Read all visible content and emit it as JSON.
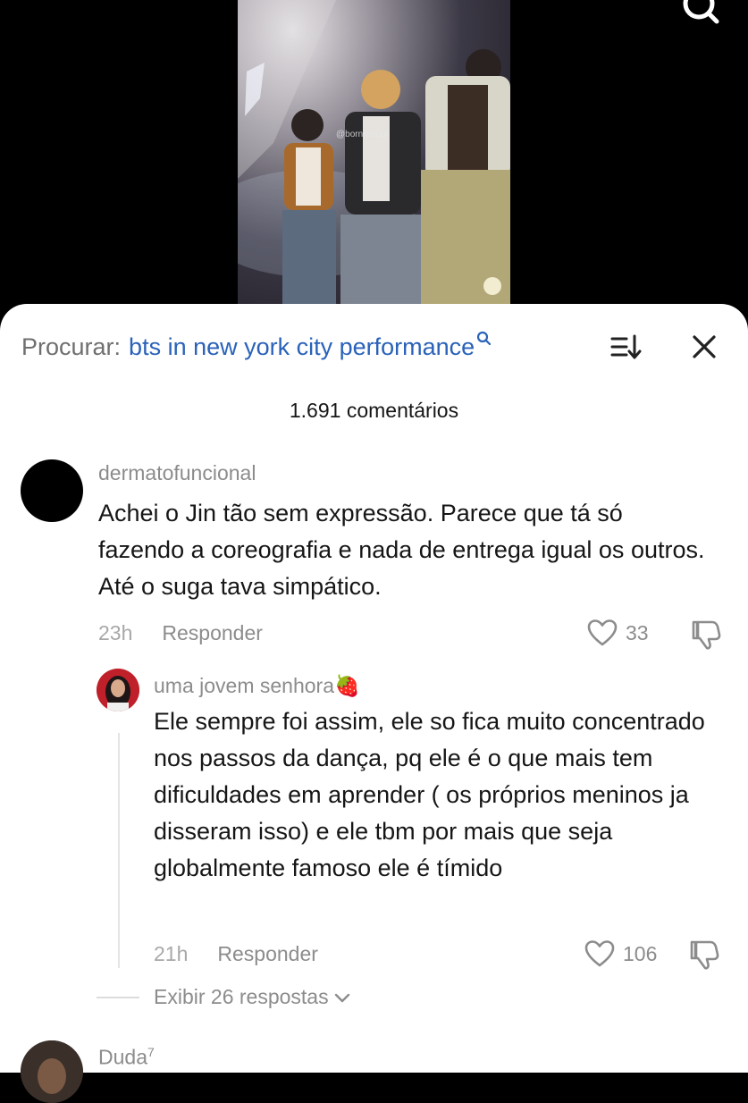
{
  "video": {
    "watermark": "@bornfortour"
  },
  "search": {
    "prefix": "Procurar:",
    "query": "bts in new york city performance"
  },
  "comment_count": "1.691 comentários",
  "comments": [
    {
      "username": "dermatofuncional",
      "text": "Achei o Jin tão sem expressão. Parece que tá só fazendo a coreografia e nada de entrega igual os outros. Até o suga tava simpático.",
      "time": "23h",
      "reply_label": "Responder",
      "likes": "33"
    }
  ],
  "replies": [
    {
      "username": "uma jovem senhora🍓",
      "text": "Ele sempre foi assim, ele so fica muito concentrado nos passos da dança, pq ele é o que mais tem dificuldades em aprender ( os próprios meninos ja disseram isso) e ele tbm por mais que seja globalmente famoso ele é tímido",
      "time": "21h",
      "reply_label": "Responder",
      "likes": "106"
    }
  ],
  "view_replies": "Exibir 26 respostas",
  "next_comment": {
    "username": "Duda",
    "username_sup": "7"
  },
  "colors": {
    "query_blue": "#2a62b9",
    "secondary_gray": "#8c8c8c",
    "text_dark": "#161616"
  }
}
